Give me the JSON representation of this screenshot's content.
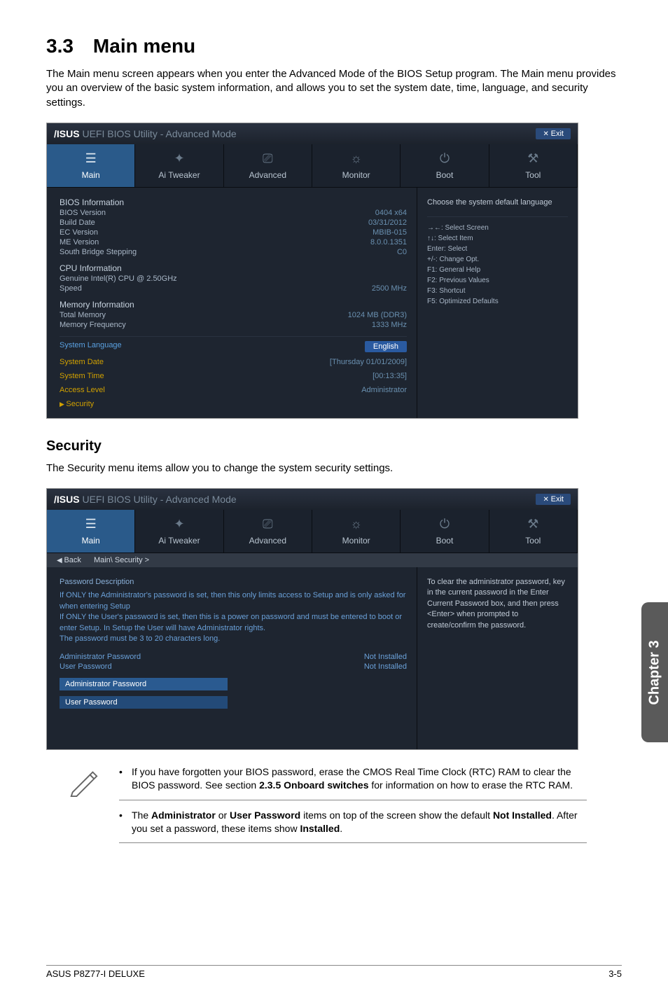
{
  "h1": "3.3 Main menu",
  "intro": "The Main menu screen appears when you enter the Advanced Mode of the BIOS Setup program. The Main menu provides you an overview of the basic system information, and allows you to set the system date, time, language, and security settings.",
  "h2": "Security",
  "sec_intro": "The Security menu items allow you to change the system security settings.",
  "bios": {
    "brand": "/ISUS",
    "title": "UEFI BIOS Utility - Advanced Mode",
    "exit": "Exit",
    "tabs": {
      "main": "Main",
      "ai": "Ai Tweaker",
      "advanced": "Advanced",
      "monitor": "Monitor",
      "boot": "Boot",
      "tool": "Tool"
    }
  },
  "scr1": {
    "groups": {
      "bios_info": "BIOS Information",
      "bios_version": "BIOS Version",
      "bios_version_v": "0404 x64",
      "build_date": "Build Date",
      "build_date_v": "03/31/2012",
      "ec_version": "EC Version",
      "ec_version_v": "MBIB-015",
      "me_version": "ME Version",
      "me_version_v": "8.0.0.1351",
      "sb": "South Bridge Stepping",
      "sb_v": "C0",
      "cpu_info": "CPU Information",
      "cpu_name": "Genuine Intel(R) CPU @ 2.50GHz",
      "speed": "Speed",
      "speed_v": "2500 MHz",
      "mem_info": "Memory Information",
      "total_mem": "Total Memory",
      "total_mem_v": "1024 MB (DDR3)",
      "mem_freq": "Memory Frequency",
      "mem_freq_v": "1333 MHz",
      "sys_lang": "System Language",
      "sys_lang_v": "English",
      "sys_date": "System Date",
      "sys_date_v": "[Thursday 01/01/2009]",
      "sys_time": "System Time",
      "sys_time_v": "[00:13:35]",
      "access": "Access Level",
      "access_v": "Administrator",
      "security": "Security"
    },
    "help": "Choose the system default language",
    "keys": {
      "a": "→←: Select Screen",
      "b": "↑↓: Select Item",
      "c": "Enter: Select",
      "d": "+/-: Change Opt.",
      "e": "F1: General Help",
      "f": "F2: Previous Values",
      "g": "F3: Shortcut",
      "h": "F5: Optimized Defaults"
    }
  },
  "scr2": {
    "back": "Back",
    "crumb": "Main\\ Security >",
    "pd_head": "Password Description",
    "pd_body": "If ONLY the Administrator's password is set, then this only limits access to Setup and is only asked for when entering Setup\nIf ONLY the User's password is set, then this is a power on password and must be entered to boot or enter Setup. In Setup the User will have Administrator rights.\nThe password must be 3 to 20 characters long.",
    "admin_pwd": "Administrator Password",
    "admin_pwd_v": "Not Installed",
    "user_pwd": "User Password",
    "user_pwd_v": "Not Installed",
    "edit_admin": "Administrator Password",
    "edit_user": "User Password",
    "help": "To clear the administrator password, key in the current password in the Enter Current Password box, and then press <Enter> when prompted to create/confirm the password."
  },
  "notes": {
    "n1a": "If you have forgotten your BIOS password, erase the CMOS Real Time Clock (RTC) RAM to clear the BIOS password. See section ",
    "n1b": "2.3.5 Onboard switches",
    "n1c": " for information on how to erase the RTC RAM.",
    "n2a": "The ",
    "n2b": "Administrator",
    "n2c": " or ",
    "n2d": "User Password",
    "n2e": " items on top of the screen show the default ",
    "n2f": "Not Installed",
    "n2g": ". After you set a password, these items show ",
    "n2h": "Installed",
    "n2i": "."
  },
  "sidetab": "Chapter 3",
  "footer": {
    "left": "ASUS P8Z77-I DELUXE",
    "right": "3-5"
  }
}
